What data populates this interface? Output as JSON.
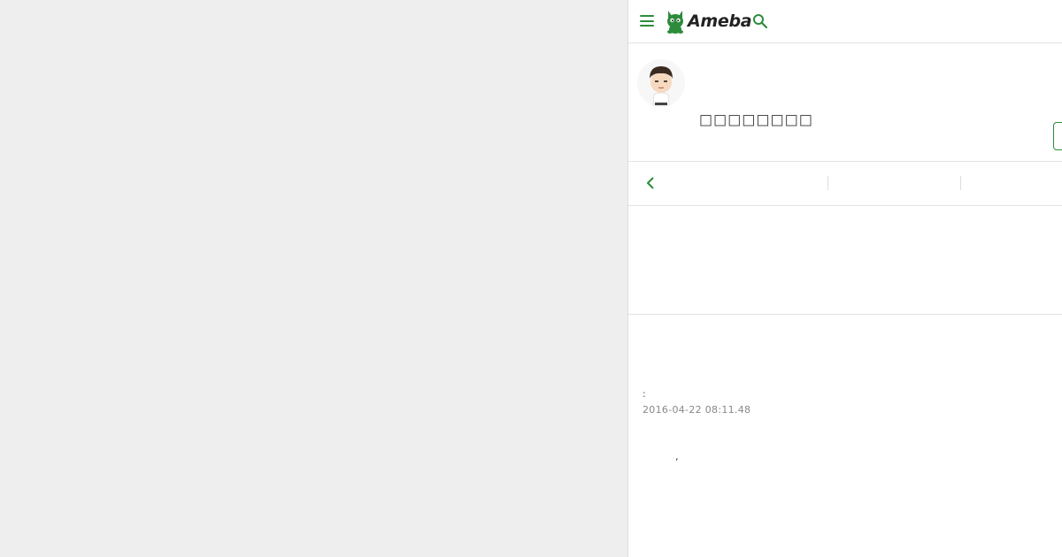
{
  "app": {
    "brand": "Ameba",
    "accent_color": "#2d8c3c"
  },
  "header": {
    "menu_icon": "hamburger-menu-icon",
    "logo_icon": "ameba-mascot-icon",
    "search_icon": "search-icon"
  },
  "profile": {
    "blog_title": "□□□□□□□□",
    "avatar_icon": "user-avatar-icon"
  },
  "nav": {
    "back_icon": "chevron-left-icon"
  },
  "article": {
    "meta_prefix": ":",
    "date": "2016-04-22 08:11.48",
    "body_text": ","
  }
}
